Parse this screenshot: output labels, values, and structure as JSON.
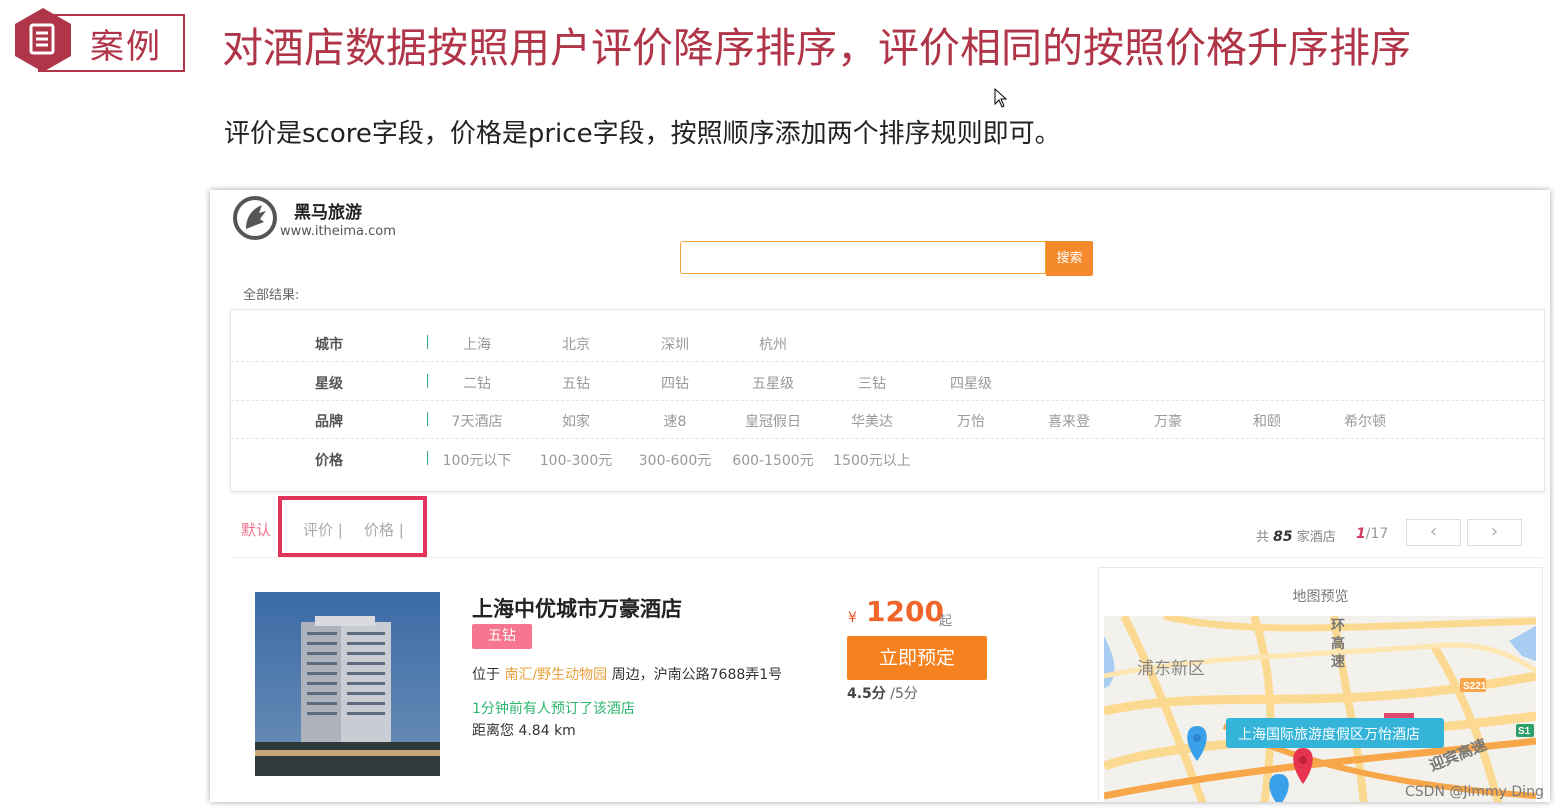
{
  "slide": {
    "badge_label": "案例",
    "title": "对酒店数据按照用户评价降序排序，评价相同的按照价格升序排序",
    "subtitle": "评价是score字段，价格是price字段，按照顺序添加两个排序规则即可。"
  },
  "site": {
    "logo_name": "黑马旅游",
    "logo_url": "www.itheima.com",
    "search_placeholder": "",
    "search_button": "搜索",
    "all_results_label": "全部结果:"
  },
  "filters": [
    {
      "label": "城市",
      "options": [
        "上海",
        "北京",
        "深圳",
        "杭州"
      ]
    },
    {
      "label": "星级",
      "options": [
        "二钻",
        "五钻",
        "四钻",
        "五星级",
        "三钻",
        "四星级"
      ]
    },
    {
      "label": "品牌",
      "options": [
        "7天酒店",
        "如家",
        "速8",
        "皇冠假日",
        "华美达",
        "万怡",
        "喜来登",
        "万豪",
        "和颐",
        "希尔顿"
      ]
    },
    {
      "label": "价格",
      "options": [
        "100元以下",
        "100-300元",
        "300-600元",
        "600-1500元",
        "1500元以上"
      ]
    }
  ],
  "sort": {
    "default": "默认",
    "score": "评价 |",
    "price": "价格 |"
  },
  "result": {
    "total_prefix": "共",
    "total_count": "85",
    "total_suffix": "家酒店",
    "page_current": "1",
    "page_total": "/17",
    "prev": "‹",
    "next": "›"
  },
  "hotel": {
    "name": "上海中优城市万豪酒店",
    "star": "五钻",
    "addr_prefix": "位于",
    "addr_area": "南汇/野生动物园",
    "addr_suffix": "周边，沪南公路7688弄1号",
    "recent": "1分钟前有人预订了该酒店",
    "distance": "距离您 4.84 km",
    "currency": "¥",
    "price": "1200",
    "price_suffix": "起",
    "book_button": "立即预定",
    "score": "4.5分",
    "score_max": "/5分"
  },
  "map": {
    "title": "地图预览",
    "district": "浦东新区",
    "ring": "环\n高\n速",
    "road_s221": "S221",
    "road_s1": "S1",
    "road_yingbin": "迎宾高速",
    "popup": "上海国际旅游度假区万怡酒店"
  },
  "watermark": "CSDN @Jimmy Ding",
  "colors": {
    "brand_red": "#b03548",
    "orange": "#f48a2c",
    "highlight_border": "#e2335a",
    "pink_badge": "#f7768f"
  }
}
